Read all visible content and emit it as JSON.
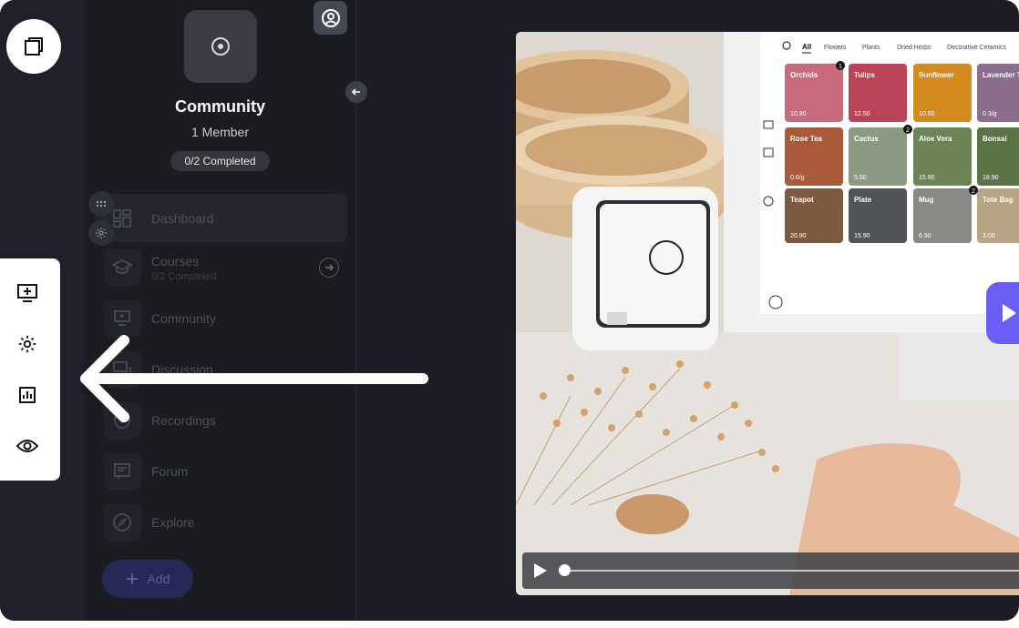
{
  "community": {
    "name": "Community",
    "members": "1 Member",
    "progress": "0/2 Completed"
  },
  "nav": [
    {
      "label": "Dashboard",
      "icon": "dashboard-icon"
    },
    {
      "label": "Courses",
      "sub": "0/2 Completed",
      "icon": "graduation-cap-icon"
    },
    {
      "label": "Community",
      "icon": "community-icon"
    },
    {
      "label": "Discussion",
      "icon": "discussion-icon"
    },
    {
      "label": "Recordings",
      "icon": "recordings-icon"
    },
    {
      "label": "Forum",
      "icon": "forum-icon"
    },
    {
      "label": "Explore",
      "icon": "compass-icon"
    }
  ],
  "add_button": {
    "label": "Add"
  },
  "toolbar": [
    "add-screen-icon",
    "settings-icon",
    "analytics-icon",
    "preview-icon"
  ],
  "shop_screen": {
    "tabs": [
      "All",
      "Flowers",
      "Plants",
      "Dried Herbs",
      "Decorative Ceramics"
    ],
    "products": [
      {
        "name": "Orchids",
        "price": "10.90",
        "badge": "1"
      },
      {
        "name": "Tulips",
        "price": "12.50",
        "badge": ""
      },
      {
        "name": "Sunflower",
        "price": "10.90",
        "badge": ""
      },
      {
        "name": "Lavender Tea",
        "price": "0.3/g",
        "badge": ""
      },
      {
        "name": "Rose Tea",
        "price": "0.6/g",
        "badge": ""
      },
      {
        "name": "Cactus",
        "price": "5.50",
        "badge": "2"
      },
      {
        "name": "Aloe Vera",
        "price": "15.90",
        "badge": ""
      },
      {
        "name": "Bonsai",
        "price": "18.90",
        "badge": ""
      },
      {
        "name": "Teapot",
        "price": "20.90",
        "badge": ""
      },
      {
        "name": "Plate",
        "price": "15.90",
        "badge": ""
      },
      {
        "name": "Mug",
        "price": "6.90",
        "badge": "2"
      },
      {
        "name": "Tote Bag",
        "price": "3.00",
        "badge": ""
      }
    ]
  },
  "colors": {
    "accent": "#6b5ef6",
    "background": "#1c1d24"
  }
}
